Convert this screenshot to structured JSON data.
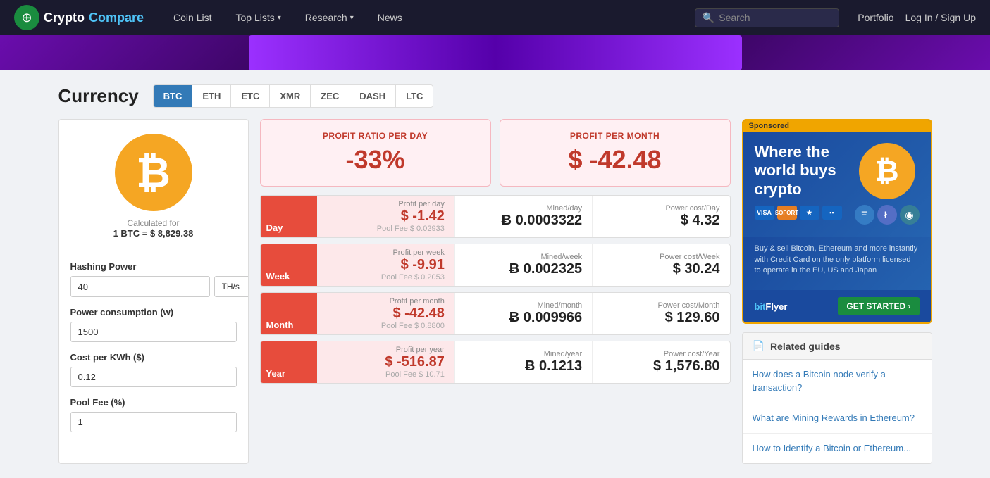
{
  "nav": {
    "logo_text_crypto": "Crypto",
    "logo_text_compare": "Compare",
    "links": [
      {
        "label": "Coin List",
        "has_arrow": false
      },
      {
        "label": "Top Lists",
        "has_arrow": true
      },
      {
        "label": "Research",
        "has_arrow": true
      },
      {
        "label": "News",
        "has_arrow": false
      }
    ],
    "search_placeholder": "Search",
    "portfolio_label": "Portfolio",
    "login_label": "Log In / Sign Up"
  },
  "currency": {
    "title": "Currency",
    "tabs": [
      "BTC",
      "ETH",
      "ETC",
      "XMR",
      "ZEC",
      "DASH",
      "LTC"
    ],
    "active_tab": "BTC"
  },
  "coin": {
    "symbol": "₿",
    "calc_label": "Calculated for",
    "calc_value": "1 BTC = $ 8,829.38"
  },
  "form": {
    "hashing_power_label": "Hashing Power",
    "hashing_power_value": "40",
    "hashing_power_unit": "TH/s",
    "power_consumption_label": "Power consumption (w)",
    "power_consumption_value": "1500",
    "cost_per_kwh_label": "Cost per KWh ($)",
    "cost_per_kwh_value": "0.12",
    "pool_fee_label": "Pool Fee (%)",
    "pool_fee_value": "1"
  },
  "summary": {
    "profit_ratio_label": "PROFIT RATIO PER DAY",
    "profit_ratio_value": "-33%",
    "profit_month_label": "PROFIT PER MONTH",
    "profit_month_value": "$ -42.48"
  },
  "rows": [
    {
      "period": "Day",
      "profit_label": "Profit per day",
      "profit_value": "$ -1.42",
      "pool_fee": "Pool Fee $ 0.02933",
      "mined_label": "Mined/day",
      "mined_value": "Ƀ 0.0003322",
      "power_label": "Power cost/Day",
      "power_value": "$ 4.32"
    },
    {
      "period": "Week",
      "profit_label": "Profit per week",
      "profit_value": "$ -9.91",
      "pool_fee": "Pool Fee $ 0.2053",
      "mined_label": "Mined/week",
      "mined_value": "Ƀ 0.002325",
      "power_label": "Power cost/Week",
      "power_value": "$ 30.24"
    },
    {
      "period": "Month",
      "profit_label": "Profit per month",
      "profit_value": "$ -42.48",
      "pool_fee": "Pool Fee $ 0.8800",
      "mined_label": "Mined/month",
      "mined_value": "Ƀ 0.009966",
      "power_label": "Power cost/Month",
      "power_value": "$ 129.60"
    },
    {
      "period": "Year",
      "profit_label": "Profit per year",
      "profit_value": "$ -516.87",
      "pool_fee": "Pool Fee $ 10.71",
      "mined_label": "Mined/year",
      "mined_value": "Ƀ 0.1213",
      "power_label": "Power cost/Year",
      "power_value": "$ 1,576.80"
    }
  ],
  "ad": {
    "sponsored_label": "Sponsored",
    "headline": "Where the world buys crypto",
    "description": "Buy & sell Bitcoin, Ethereum and more instantly with Credit Card on the only platform licensed to operate in the EU, US and Japan",
    "payment_icons": [
      "VISA",
      "SOFORT",
      "★★",
      "▪▪"
    ],
    "cta_label": "GET STARTED ›",
    "logo_text": "bitFlyer"
  },
  "related_guides": {
    "header": "Related guides",
    "links": [
      "How does a Bitcoin node verify a transaction?",
      "What are Mining Rewards in Ethereum?",
      "How to Identify a Bitcoin or Ethereum..."
    ]
  }
}
